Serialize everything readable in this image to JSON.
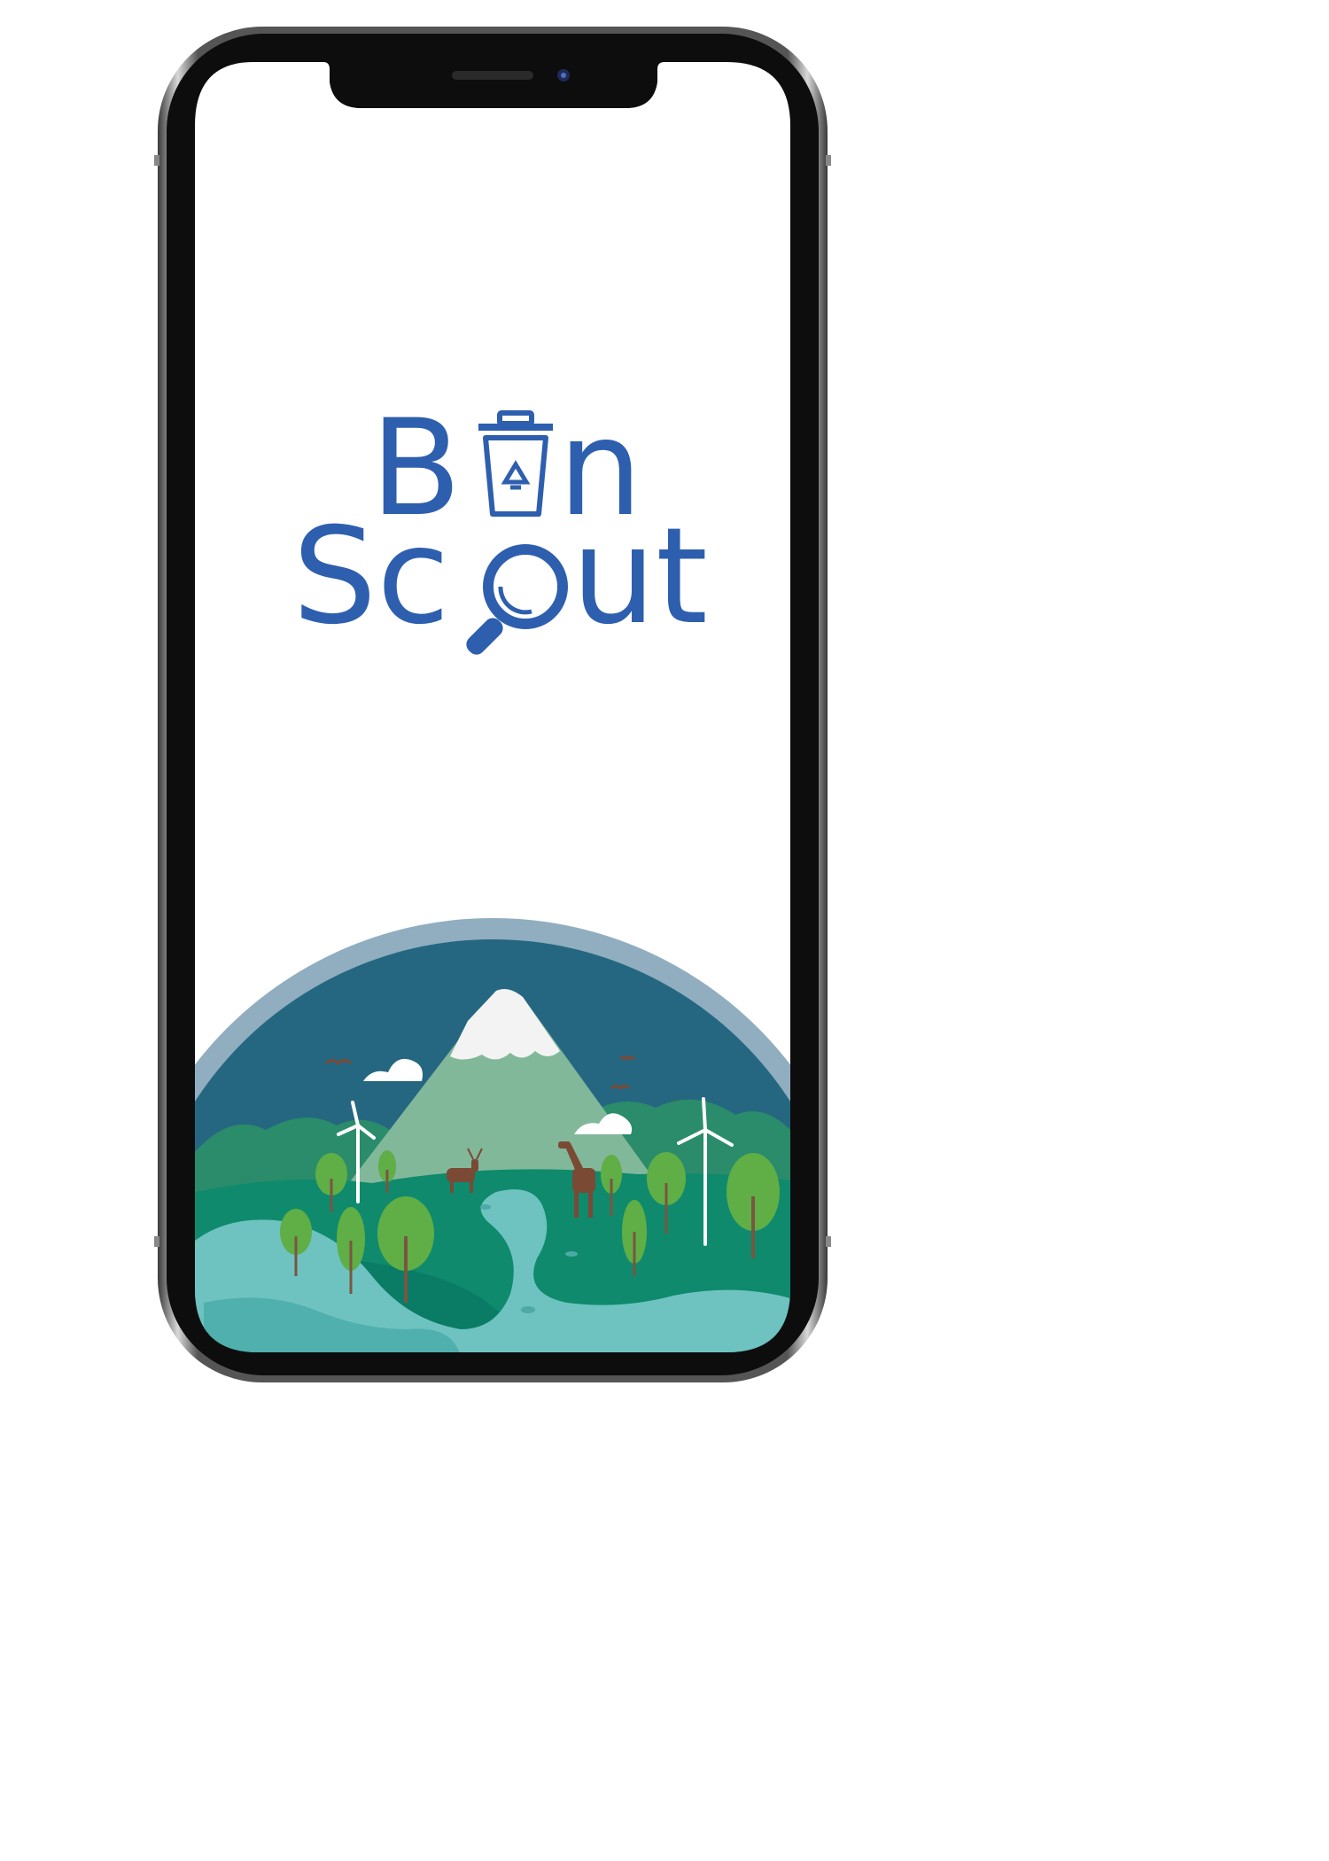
{
  "app": {
    "logo_line1_start": "B",
    "logo_line1_end": "n",
    "logo_line2_start": "Sc",
    "logo_line2_end": "ut"
  },
  "colors": {
    "brand": "#2e5fae",
    "sky": "#256781",
    "sky_halo": "#90aec0",
    "mountain": "#82b89a",
    "snow": "#f3f3f3",
    "ground": "#0f8a6d",
    "water": "#6ec3c1",
    "tree": "#5fae46",
    "trunk": "#7a5640",
    "animal": "#7a4a35"
  },
  "icons": {
    "bin": "recycling-bin-icon",
    "magnifier": "magnifying-glass-icon",
    "recycle": "recycle-arrows-icon"
  }
}
